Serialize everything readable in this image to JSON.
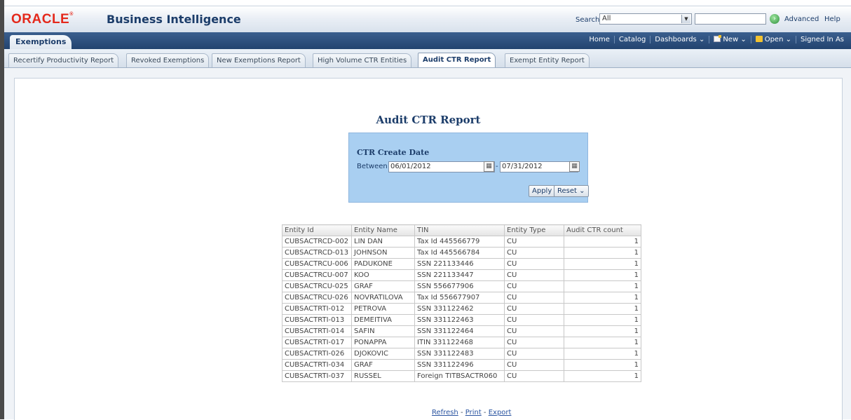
{
  "header": {
    "logo": "ORACLE",
    "app_title": "Business Intelligence",
    "search_label": "Search",
    "search_scope": "All",
    "search_query": "",
    "advanced_label": "Advanced",
    "help_label": "Help"
  },
  "dashboard": {
    "name": "Exemptions",
    "menu": {
      "home": "Home",
      "catalog": "Catalog",
      "dashboards": "Dashboards ⌄",
      "new": "New ⌄",
      "open": "Open ⌄",
      "signed_in": "Signed In As"
    }
  },
  "tabs": [
    "Recertify Productivity Report",
    "Revoked Exemptions",
    "New Exemptions Report",
    "High Volume CTR Entities",
    "Audit CTR Report",
    "Exempt Entity Report"
  ],
  "active_tab": "Audit CTR Report",
  "report": {
    "title": "Audit CTR Report",
    "prompt": {
      "label": "CTR Create Date",
      "between_label": "Between",
      "date_from": "06/01/2012",
      "separator": "-",
      "date_to": "07/31/2012",
      "apply_label": "Apply",
      "reset_label": "Reset ⌄"
    },
    "table": {
      "columns": [
        "Entity Id",
        "Entity Name",
        "TIN",
        "Entity Type",
        "Audit CTR count"
      ],
      "rows": [
        [
          "CUBSACTRCD-002",
          "LIN DAN",
          "Tax Id 445566779",
          "CU",
          "1"
        ],
        [
          "CUBSACTRCD-013",
          "JOHNSON",
          "Tax Id 445566784",
          "CU",
          "1"
        ],
        [
          "CUBSACTRCU-006",
          "PADUKONE",
          "SSN 221133446",
          "CU",
          "1"
        ],
        [
          "CUBSACTRCU-007",
          "KOO",
          "SSN 221133447",
          "CU",
          "1"
        ],
        [
          "CUBSACTRCU-025",
          "GRAF",
          "SSN 556677906",
          "CU",
          "1"
        ],
        [
          "CUBSACTRCU-026",
          "NOVRATILOVA",
          "Tax Id 556677907",
          "CU",
          "1"
        ],
        [
          "CUBSACTRTI-012",
          "PETROVA",
          "SSN 331122462",
          "CU",
          "1"
        ],
        [
          "CUBSACTRTI-013",
          "DEMEITIVA",
          "SSN 331122463",
          "CU",
          "1"
        ],
        [
          "CUBSACTRTI-014",
          "SAFIN",
          "SSN 331122464",
          "CU",
          "1"
        ],
        [
          "CUBSACTRTI-017",
          "PONAPPA",
          "ITIN 331122468",
          "CU",
          "1"
        ],
        [
          "CUBSACTRTI-026",
          "DJOKOVIC",
          "SSN 331122483",
          "CU",
          "1"
        ],
        [
          "CUBSACTRTI-034",
          "GRAF",
          "SSN 331122496",
          "CU",
          "1"
        ],
        [
          "CUBSACTRTI-037",
          "RUSSEL",
          "Foreign TITBSACTR060",
          "CU",
          "1"
        ]
      ]
    },
    "links": {
      "refresh": "Refresh",
      "print": "Print",
      "export": "Export"
    }
  },
  "icons": {
    "calendar": "calendar-icon",
    "go": "go-icon",
    "new": "new-document-icon",
    "open": "folder-icon"
  }
}
